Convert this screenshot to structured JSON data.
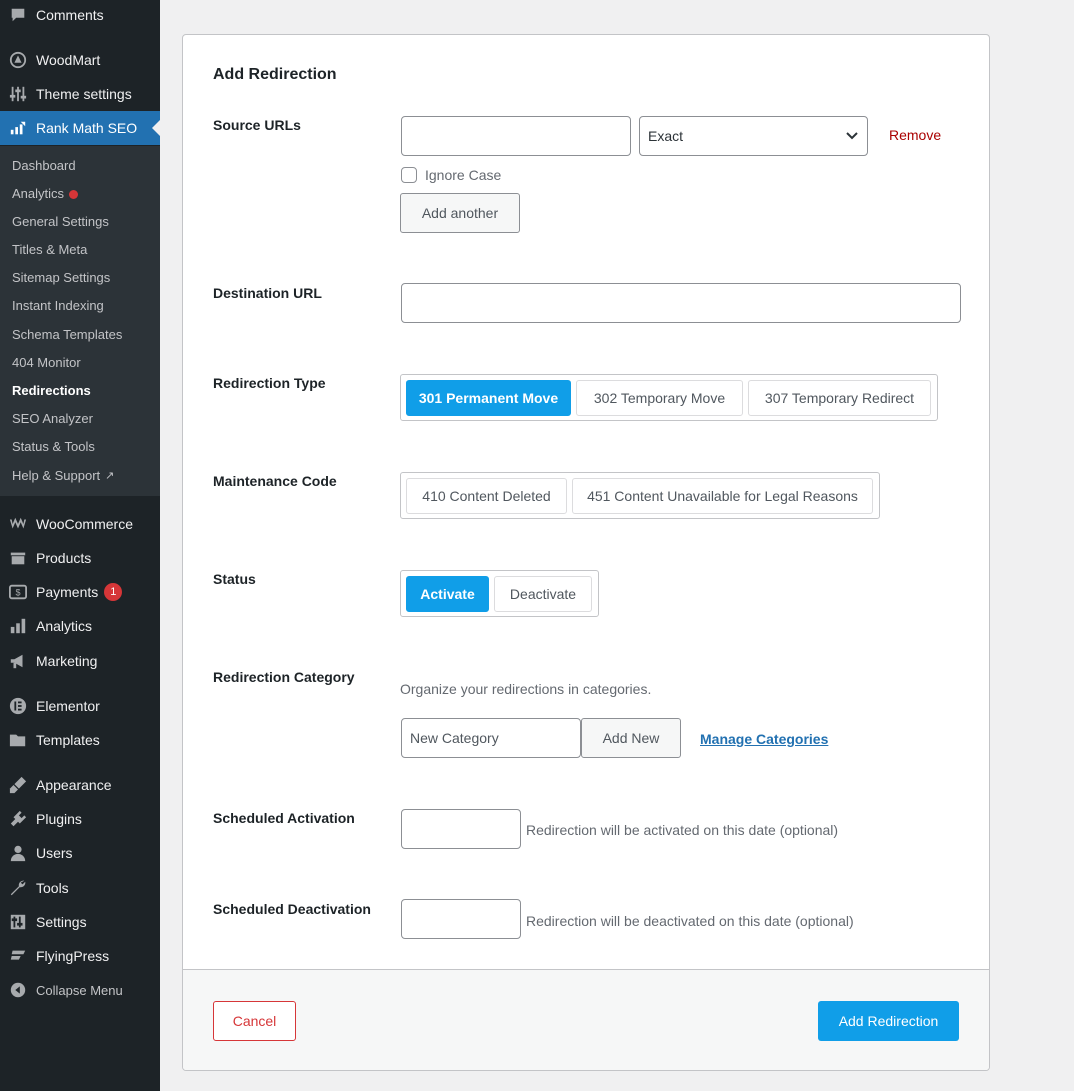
{
  "sidebar": {
    "top_items": [
      {
        "label": "Comments",
        "icon": "comment-icon"
      },
      {
        "label": "WoodMart",
        "icon": "woodmart-icon"
      },
      {
        "label": "Theme settings",
        "icon": "sliders-icon"
      },
      {
        "label": "Rank Math SEO",
        "icon": "rank-math-icon"
      }
    ],
    "submenu": [
      {
        "label": "Dashboard"
      },
      {
        "label": "Analytics"
      },
      {
        "label": "General Settings"
      },
      {
        "label": "Titles & Meta"
      },
      {
        "label": "Sitemap Settings"
      },
      {
        "label": "Instant Indexing"
      },
      {
        "label": "Schema Templates"
      },
      {
        "label": "404 Monitor"
      },
      {
        "label": "Redirections"
      },
      {
        "label": "SEO Analyzer"
      },
      {
        "label": "Status & Tools"
      },
      {
        "label": "Help & Support"
      }
    ],
    "bottom_items": [
      {
        "label": "WooCommerce",
        "icon": "woocommerce-icon"
      },
      {
        "label": "Products",
        "icon": "products-icon"
      },
      {
        "label": "Payments",
        "icon": "payments-icon",
        "badge": "1"
      },
      {
        "label": "Analytics",
        "icon": "analytics-icon"
      },
      {
        "label": "Marketing",
        "icon": "megaphone-icon"
      },
      {
        "label": "Elementor",
        "icon": "elementor-icon"
      },
      {
        "label": "Templates",
        "icon": "folder-icon"
      },
      {
        "label": "Appearance",
        "icon": "brush-icon"
      },
      {
        "label": "Plugins",
        "icon": "plugin-icon"
      },
      {
        "label": "Users",
        "icon": "users-icon"
      },
      {
        "label": "Tools",
        "icon": "wrench-icon"
      },
      {
        "label": "Settings",
        "icon": "settings-icon"
      },
      {
        "label": "FlyingPress",
        "icon": "flyingpress-icon"
      }
    ],
    "collapse_label": "Collapse Menu"
  },
  "form": {
    "title": "Add Redirection",
    "source": {
      "label": "Source URLs",
      "url_value": "",
      "match_type": "Exact",
      "remove_label": "Remove",
      "ignore_case_label": "Ignore Case",
      "ignore_case_checked": false,
      "add_another_label": "Add another"
    },
    "destination": {
      "label": "Destination URL",
      "value": ""
    },
    "redirection_type": {
      "label": "Redirection Type",
      "options": [
        "301 Permanent Move",
        "302 Temporary Move",
        "307 Temporary Redirect"
      ],
      "selected": "301 Permanent Move"
    },
    "maintenance_code": {
      "label": "Maintenance Code",
      "options": [
        "410 Content Deleted",
        "451 Content Unavailable for Legal Reasons"
      ]
    },
    "status": {
      "label": "Status",
      "options": [
        "Activate",
        "Deactivate"
      ],
      "selected": "Activate"
    },
    "category": {
      "label": "Redirection Category",
      "description": "Organize your redirections in categories.",
      "placeholder": "New Category",
      "add_new_label": "Add New",
      "manage_label": "Manage Categories"
    },
    "scheduled_activation": {
      "label": "Scheduled Activation",
      "description": "Redirection will be activated on this date (optional)"
    },
    "scheduled_deactivation": {
      "label": "Scheduled Deactivation",
      "description": "Redirection will be deactivated on this date (optional)"
    },
    "cancel_label": "Cancel",
    "submit_label": "Add Redirection"
  },
  "colors": {
    "accent": "#109ee8",
    "sidebar_bg": "#1d2327",
    "sidebar_active": "#2271b1",
    "danger": "#d63638"
  }
}
